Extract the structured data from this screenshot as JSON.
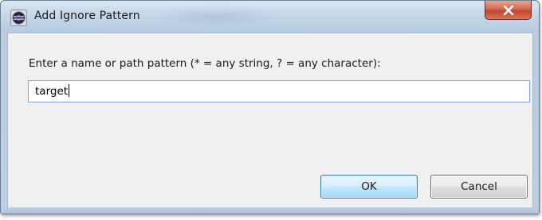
{
  "window": {
    "title": "Add Ignore Pattern",
    "app_icon": "eclipse-icon",
    "close_icon": "close-icon"
  },
  "dialog": {
    "prompt": "Enter a name or path pattern (* = any string, ? = any character):",
    "pattern_value": "target"
  },
  "buttons": {
    "ok_label": "OK",
    "cancel_label": "Cancel"
  },
  "colors": {
    "close_button": "#c0442b",
    "default_button_border": "#3c7fb1",
    "input_focus_border": "#7aa7d8"
  }
}
